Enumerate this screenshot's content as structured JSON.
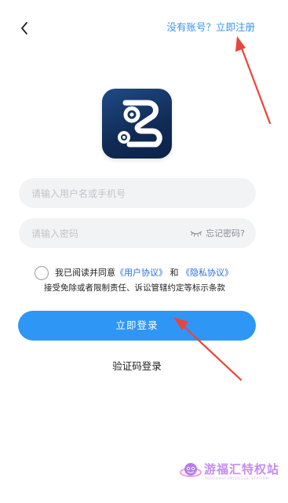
{
  "header": {
    "back_icon": "chevron-left-icon",
    "no_account_text": "没有账号？",
    "register_link": "立即注册"
  },
  "logo": {
    "icon": "app-logo-icon",
    "colors": {
      "background": "#12305e",
      "mark": "#ffffff"
    }
  },
  "form": {
    "username_placeholder": "请输入用户名或手机号",
    "username_value": "",
    "password_placeholder": "请输入密码",
    "password_value": "",
    "eye_icon": "eye-closed-icon",
    "forgot_password": "忘记密码?"
  },
  "agreement": {
    "checked": false,
    "prefix": "我已阅读并同意",
    "user_agreement": "《用户协议》",
    "and": "和",
    "privacy_policy": "《隐私协议》",
    "line2": "接受免除或者限制责任、诉讼管辖约定等标示条款"
  },
  "actions": {
    "login_label": "立即登录",
    "sms_login_label": "验证码登录"
  },
  "watermark": {
    "text": "游福汇特权站",
    "sub": "YOUFUHUI PRIVILEGE STATION"
  },
  "colors": {
    "accent": "#2e96f5",
    "link": "#3a94e8",
    "annotation": "#e8453c",
    "field_bg": "#f2f3f5"
  }
}
